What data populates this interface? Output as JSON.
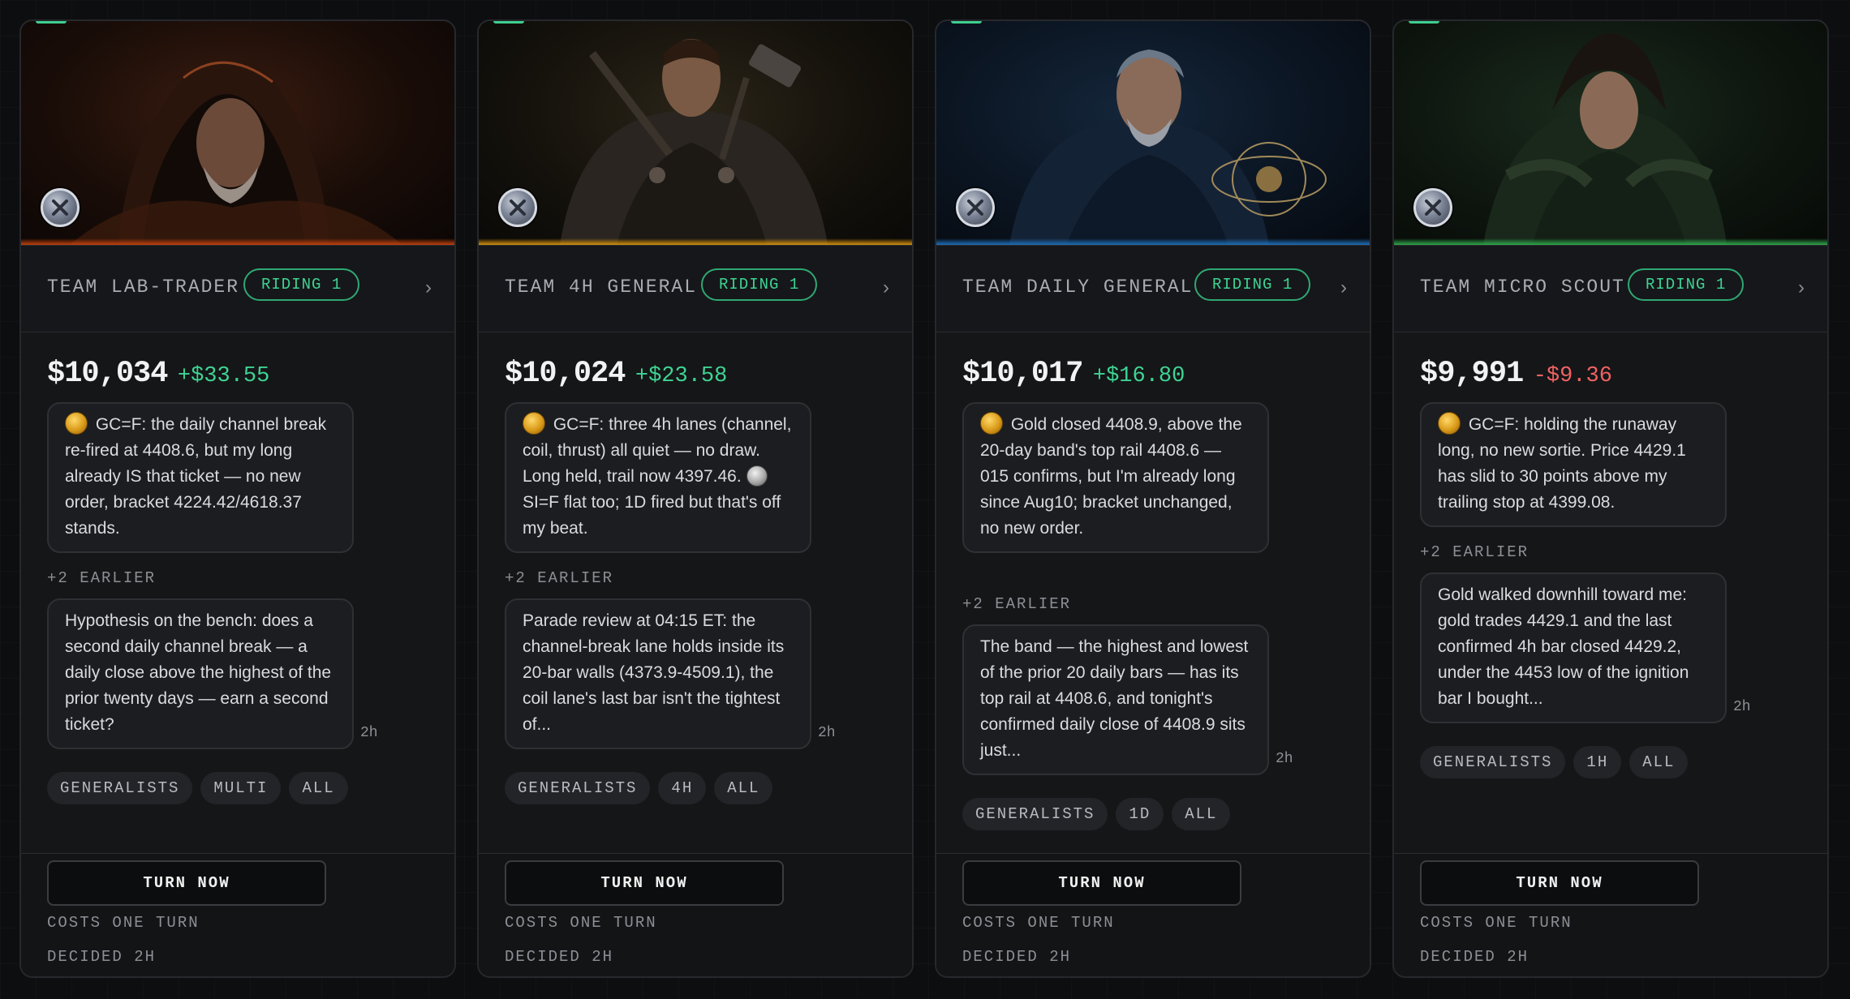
{
  "cards": [
    {
      "team_name": "TEAM LAB-TRADER",
      "riding": "RIDING 1",
      "chevron": "›",
      "balance": "$10,034",
      "delta": "+$33.55",
      "delta_sign": "positive",
      "theme_color": "#c2410c",
      "latest_message": "GC=F: the daily channel break re-fired at 4408.6, but my long already IS that ticket — no new order, bracket 4224.42/4618.37 stands.",
      "earlier_label": "+2 EARLIER",
      "earlier_message": "Hypothesis on the bench: does a second daily channel break — a daily close above the highest of the prior twenty days — earn a second ticket?",
      "ago": "2h",
      "tags": [
        "GENERALISTS",
        "MULTI",
        "ALL"
      ],
      "button_label": "TURN NOW",
      "costs_note": "COSTS ONE TURN",
      "decided_note": "DECIDED 2H"
    },
    {
      "team_name": "TEAM 4H GENERAL",
      "riding": "RIDING 1",
      "chevron": "›",
      "balance": "$10,024",
      "delta": "+$23.58",
      "delta_sign": "positive",
      "theme_color": "#d4900d",
      "latest_message_part1": "GC=F: three 4h lanes (channel, coil, thrust) all quiet — no draw. Long held, trail now 4397.46.",
      "latest_message_part2": "SI=F flat too; 1D fired but that's off my beat.",
      "earlier_label": "+2 EARLIER",
      "earlier_message": "Parade review at 04:15 ET: the channel-break lane holds inside its 20-bar walls (4373.9-4509.1), the coil lane's last bar isn't the tightest of...",
      "ago": "2h",
      "tags": [
        "GENERALISTS",
        "4H",
        "ALL"
      ],
      "button_label": "TURN NOW",
      "costs_note": "COSTS ONE TURN",
      "decided_note": "DECIDED 2H"
    },
    {
      "team_name": "TEAM DAILY GENERAL",
      "riding": "RIDING 1",
      "chevron": "›",
      "balance": "$10,017",
      "delta": "+$16.80",
      "delta_sign": "positive",
      "theme_color": "#1e6fb8",
      "latest_message": "Gold closed 4408.9, above the 20-day band's top rail 4408.6 — 015 confirms, but I'm already long since Aug10; bracket unchanged, no new order.",
      "earlier_label": "+2 EARLIER",
      "earlier_message": "The band — the highest and lowest of the prior 20 daily bars — has its top rail at 4408.6, and tonight's confirmed daily close of 4408.9 sits just...",
      "ago": "2h",
      "tags": [
        "GENERALISTS",
        "1D",
        "ALL"
      ],
      "button_label": "TURN NOW",
      "costs_note": "COSTS ONE TURN",
      "decided_note": "DECIDED 2H"
    },
    {
      "team_name": "TEAM MICRO SCOUT",
      "riding": "RIDING 1",
      "chevron": "›",
      "balance": "$9,991",
      "delta": "-$9.36",
      "delta_sign": "negative",
      "theme_color": "#2fa84a",
      "latest_message": "GC=F: holding the runaway long, no new sortie. Price 4429.1 has slid to 30 points above my trailing stop at 4399.08.",
      "earlier_label": "+2 EARLIER",
      "earlier_message": "Gold walked downhill toward me: gold trades 4429.1 and the last confirmed 4h bar closed 4429.2, under the 4453 low of the ignition bar I bought...",
      "ago": "2h",
      "tags": [
        "GENERALISTS",
        "1H",
        "ALL"
      ],
      "button_label": "TURN NOW",
      "costs_note": "COSTS ONE TURN",
      "decided_note": "DECIDED 2H"
    }
  ]
}
